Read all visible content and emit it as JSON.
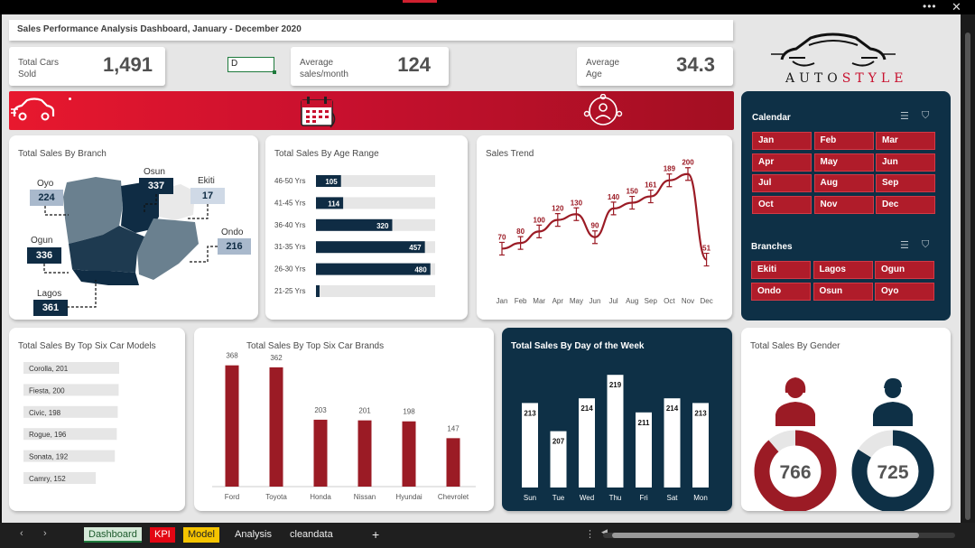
{
  "window": {
    "menu_dots": "•••",
    "close": "✕"
  },
  "title": "Sales Performance Analysis Dashboard, January - December 2020",
  "kpis": [
    {
      "label": "Total Cars Sold",
      "value": "1,491"
    },
    {
      "label": "Average sales/month",
      "value": "124"
    },
    {
      "label": "Average Age",
      "value": "34.3"
    }
  ],
  "cell_editor": {
    "value": "D"
  },
  "logo": {
    "part1": "AUTO",
    "part2": "STYLE"
  },
  "banner": {
    "icons": [
      "car-icon",
      "calendar-icon",
      "people-icon"
    ]
  },
  "branch_card": {
    "title": "Total Sales By Branch",
    "branches": [
      {
        "name": "Oyo",
        "value": "224"
      },
      {
        "name": "Osun",
        "value": "337"
      },
      {
        "name": "Ekiti",
        "value": "17"
      },
      {
        "name": "Ogun",
        "value": "336"
      },
      {
        "name": "Ondo",
        "value": "216"
      },
      {
        "name": "Lagos",
        "value": "361"
      }
    ]
  },
  "slicers": {
    "calendar": {
      "title": "Calendar",
      "items": [
        "Jan",
        "Feb",
        "Mar",
        "Apr",
        "May",
        "Jun",
        "Jul",
        "Aug",
        "Sep",
        "Oct",
        "Nov",
        "Dec"
      ]
    },
    "branches": {
      "title": "Branches",
      "items": [
        "Ekiti",
        "Lagos",
        "Ogun",
        "Ondo",
        "Osun",
        "Oyo"
      ]
    }
  },
  "sheets": {
    "tabs": [
      "Dashboard",
      "KPI",
      "Model",
      "Analysis",
      "cleandata"
    ],
    "add": "+"
  },
  "colors": {
    "accent": "#9b1b25",
    "navy": "#0e3046",
    "navy_bar": "#0f2c44",
    "light_bar": "#e6e6e6",
    "slicer_btn": "#b01c2a"
  },
  "chart_data": [
    {
      "type": "bar",
      "orientation": "horizontal",
      "title": "Total Sales By Age Range",
      "categories": [
        "46-50 Yrs",
        "41-45 Yrs",
        "36-40 Yrs",
        "31-35 Yrs",
        "26-30 Yrs",
        "21-25 Yrs"
      ],
      "values": [
        105,
        114,
        320,
        457,
        480,
        15
      ],
      "labels": [
        "105",
        "114",
        "320",
        "457",
        "480",
        ""
      ],
      "xlim": [
        0,
        500
      ]
    },
    {
      "type": "line",
      "title": "Sales Trend",
      "x": [
        "Jan",
        "Feb",
        "Mar",
        "Apr",
        "May",
        "Jun",
        "Jul",
        "Aug",
        "Sep",
        "Oct",
        "Nov",
        "Dec"
      ],
      "values": [
        70,
        80,
        100,
        120,
        130,
        90,
        140,
        150,
        161,
        189,
        200,
        51
      ],
      "labels": [
        "70",
        "80",
        "100",
        "120",
        "130",
        "90",
        "140",
        "150",
        "161",
        "189",
        "200",
        "51"
      ],
      "error_bars": true,
      "ylim": [
        0,
        220
      ]
    },
    {
      "type": "bar",
      "orientation": "horizontal",
      "title": "Total Sales By Top Six Car Models",
      "categories": [
        "Corolla",
        "Fiesta",
        "Civic",
        "Rogue",
        "Sonata",
        "Camry"
      ],
      "values": [
        201,
        200,
        198,
        196,
        192,
        152
      ],
      "labels": [
        "Corolla, 201",
        "Fiesta, 200",
        "Civic, 198",
        "Rogue, 196",
        "Sonata, 192",
        "Camry, 152"
      ],
      "xlim": [
        0,
        220
      ]
    },
    {
      "type": "bar",
      "title": "Total Sales By Top Six Car Brands",
      "categories": [
        "Ford",
        "Toyota",
        "Honda",
        "Nissan",
        "Hyundai",
        "Chevrolet"
      ],
      "values": [
        368,
        362,
        203,
        201,
        198,
        147
      ],
      "ylim": [
        0,
        400
      ]
    },
    {
      "type": "bar",
      "title": "Total Sales By Day of the Week",
      "categories": [
        "Sun",
        "Tue",
        "Wed",
        "Thu",
        "Fri",
        "Sat",
        "Mon"
      ],
      "values": [
        213,
        207,
        214,
        219,
        211,
        214,
        213
      ],
      "ylim": [
        195,
        220
      ]
    },
    {
      "type": "pie",
      "title": "Total Sales By Gender",
      "segments": [
        {
          "name": "Female",
          "value": 766,
          "label": "766"
        },
        {
          "name": "Male",
          "value": 725,
          "label": "725"
        }
      ],
      "total": 1491
    }
  ]
}
